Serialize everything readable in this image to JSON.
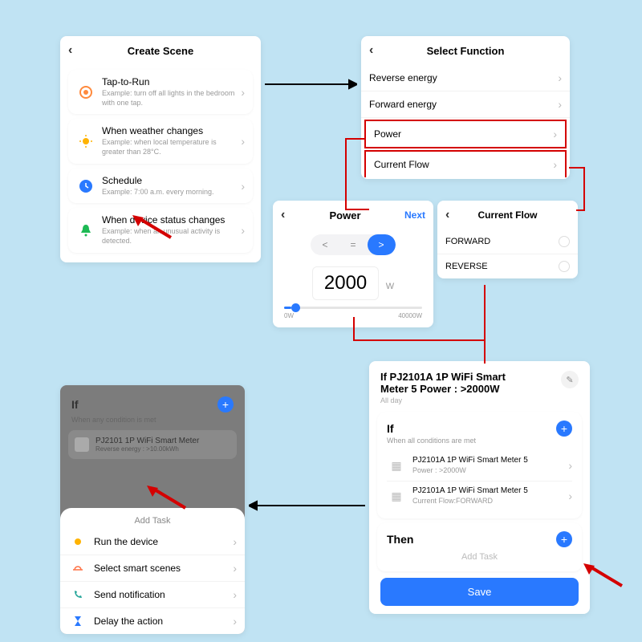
{
  "createScene": {
    "title": "Create Scene",
    "items": [
      {
        "title": "Tap-to-Run",
        "sub": "Example: turn off all lights in the bedroom with one tap."
      },
      {
        "title": "When weather changes",
        "sub": "Example: when local temperature is greater than 28°C."
      },
      {
        "title": "Schedule",
        "sub": "Example: 7:00 a.m. every morning."
      },
      {
        "title": "When device status changes",
        "sub": "Example: when an unusual activity is detected."
      }
    ]
  },
  "selectFunction": {
    "title": "Select Function",
    "items": [
      "Reverse energy",
      "Forward energy",
      "Power",
      "Current Flow"
    ]
  },
  "power": {
    "title": "Power",
    "next": "Next",
    "value": "2000",
    "unit": "W",
    "min": "0W",
    "max": "40000W",
    "ops": {
      "lt": "<",
      "eq": "=",
      "gt": ">"
    }
  },
  "currentFlow": {
    "title": "Current Flow",
    "opt1": "FORWARD",
    "opt2": "REVERSE"
  },
  "scene": {
    "title1": "If PJ2101A 1P WiFi Smart",
    "title2": "Meter  5 Power : >2000W",
    "allday": "All day",
    "if": {
      "label": "If",
      "sub": "When all conditions are met"
    },
    "c1": {
      "name": "PJ2101A 1P WiFi Smart Meter 5",
      "detail": "Power : >2000W"
    },
    "c2": {
      "name": "PJ2101A 1P WiFi Smart Meter 5",
      "detail": "Current Flow:FORWARD"
    },
    "then": "Then",
    "addTask": "Add Task",
    "save": "Save"
  },
  "ifPanel": {
    "if": "If",
    "sub": "When any condition is met",
    "dev": "PJ2101 1P WiFi Smart Meter",
    "devsub": "Reverse energy : >10.00kWh",
    "addTask": "Add Task",
    "items": [
      "Run the device",
      "Select smart scenes",
      "Send notification",
      "Delay the action"
    ]
  }
}
